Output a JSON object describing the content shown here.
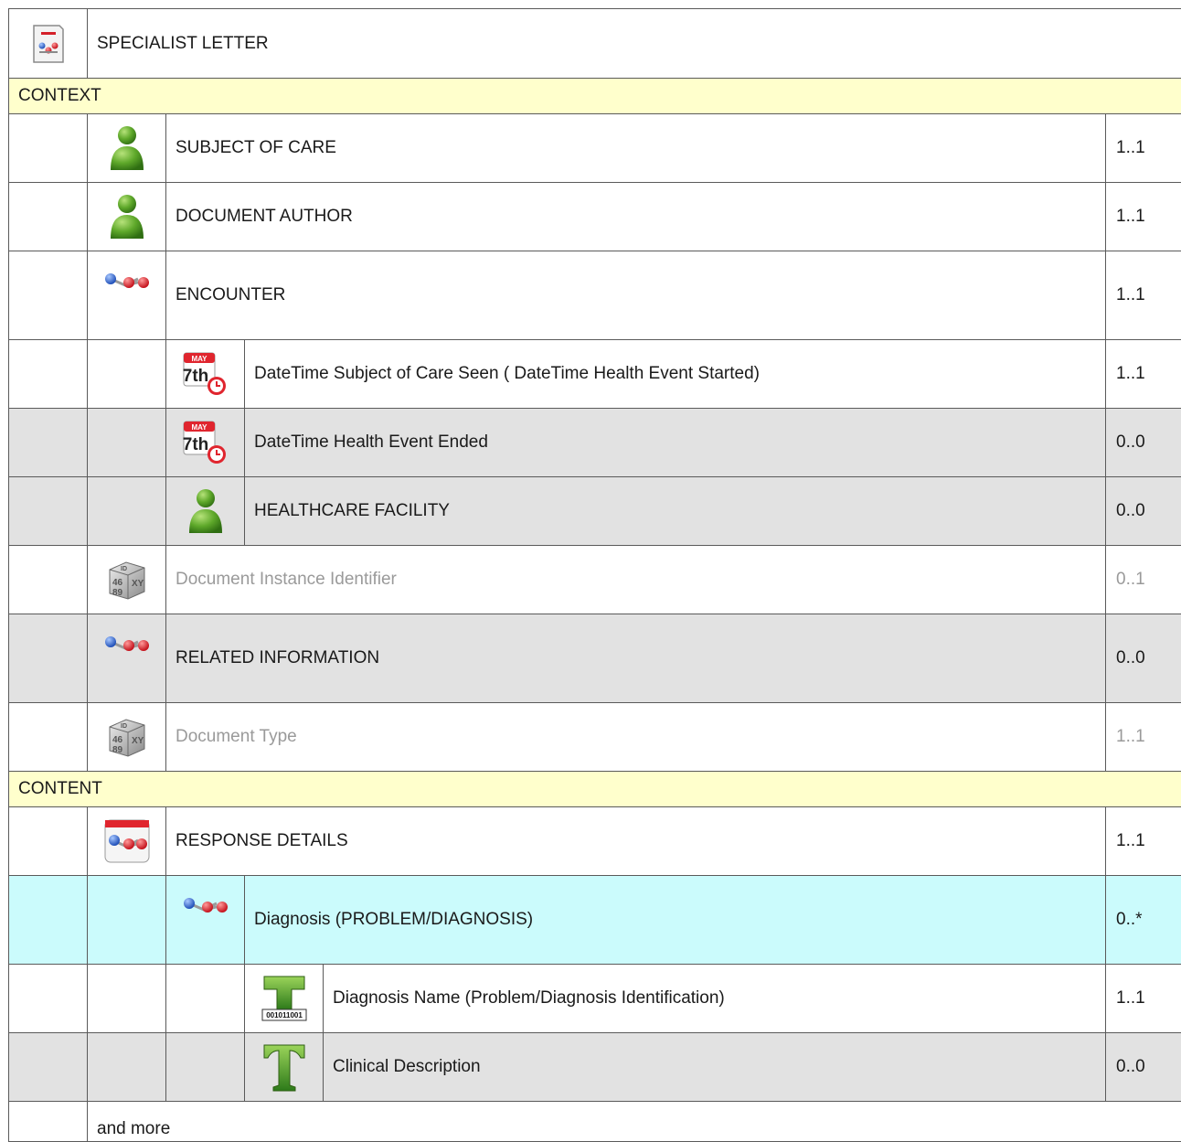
{
  "title": "SPECIALIST LETTER",
  "sections": {
    "context": "CONTEXT",
    "content": "CONTENT"
  },
  "rows": [
    {
      "label": "SUBJECT OF CARE",
      "card": "1..1",
      "icon": "person-icon"
    },
    {
      "label": "DOCUMENT AUTHOR",
      "card": "1..1",
      "icon": "person-icon"
    },
    {
      "label": "ENCOUNTER",
      "card": "1..1",
      "icon": "molecule-icon"
    },
    {
      "label": "DateTime Subject of Care Seen ( DateTime Health Event Started)",
      "card": "1..1",
      "icon": "calendar-clock-icon",
      "calendar_month": "MAY",
      "calendar_day": "7th"
    },
    {
      "label": "DateTime Health Event Ended",
      "card": "0..0",
      "icon": "calendar-clock-icon",
      "calendar_month": "MAY",
      "calendar_day": "7th"
    },
    {
      "label": "HEALTHCARE FACILITY",
      "card": "0..0",
      "icon": "person-icon"
    },
    {
      "label": "Document Instance Identifier",
      "card": "0..1",
      "icon": "id-cube-icon"
    },
    {
      "label": "RELATED INFORMATION",
      "card": "0..0",
      "icon": "molecule-icon"
    },
    {
      "label": "Document Type",
      "card": "1..1",
      "icon": "id-cube-icon"
    },
    {
      "label": "RESPONSE DETAILS",
      "card": "1..1",
      "icon": "section-document-icon"
    },
    {
      "label": "Diagnosis (PROBLEM/DIAGNOSIS)",
      "card": "0..*",
      "icon": "molecule-icon"
    },
    {
      "label": "Diagnosis Name (Problem/Diagnosis Identification)",
      "card": "1..1",
      "icon": "coded-text-icon",
      "code_text": "001011001"
    },
    {
      "label": "Clinical Description",
      "card": "0..0",
      "icon": "text-icon"
    }
  ],
  "footer": "and more",
  "colors": {
    "section_bg": "#ffffcc",
    "disabled_bg": "#e2e2e2",
    "selected_bg": "#cbfbfc",
    "dim_text": "#9a9a9a"
  }
}
